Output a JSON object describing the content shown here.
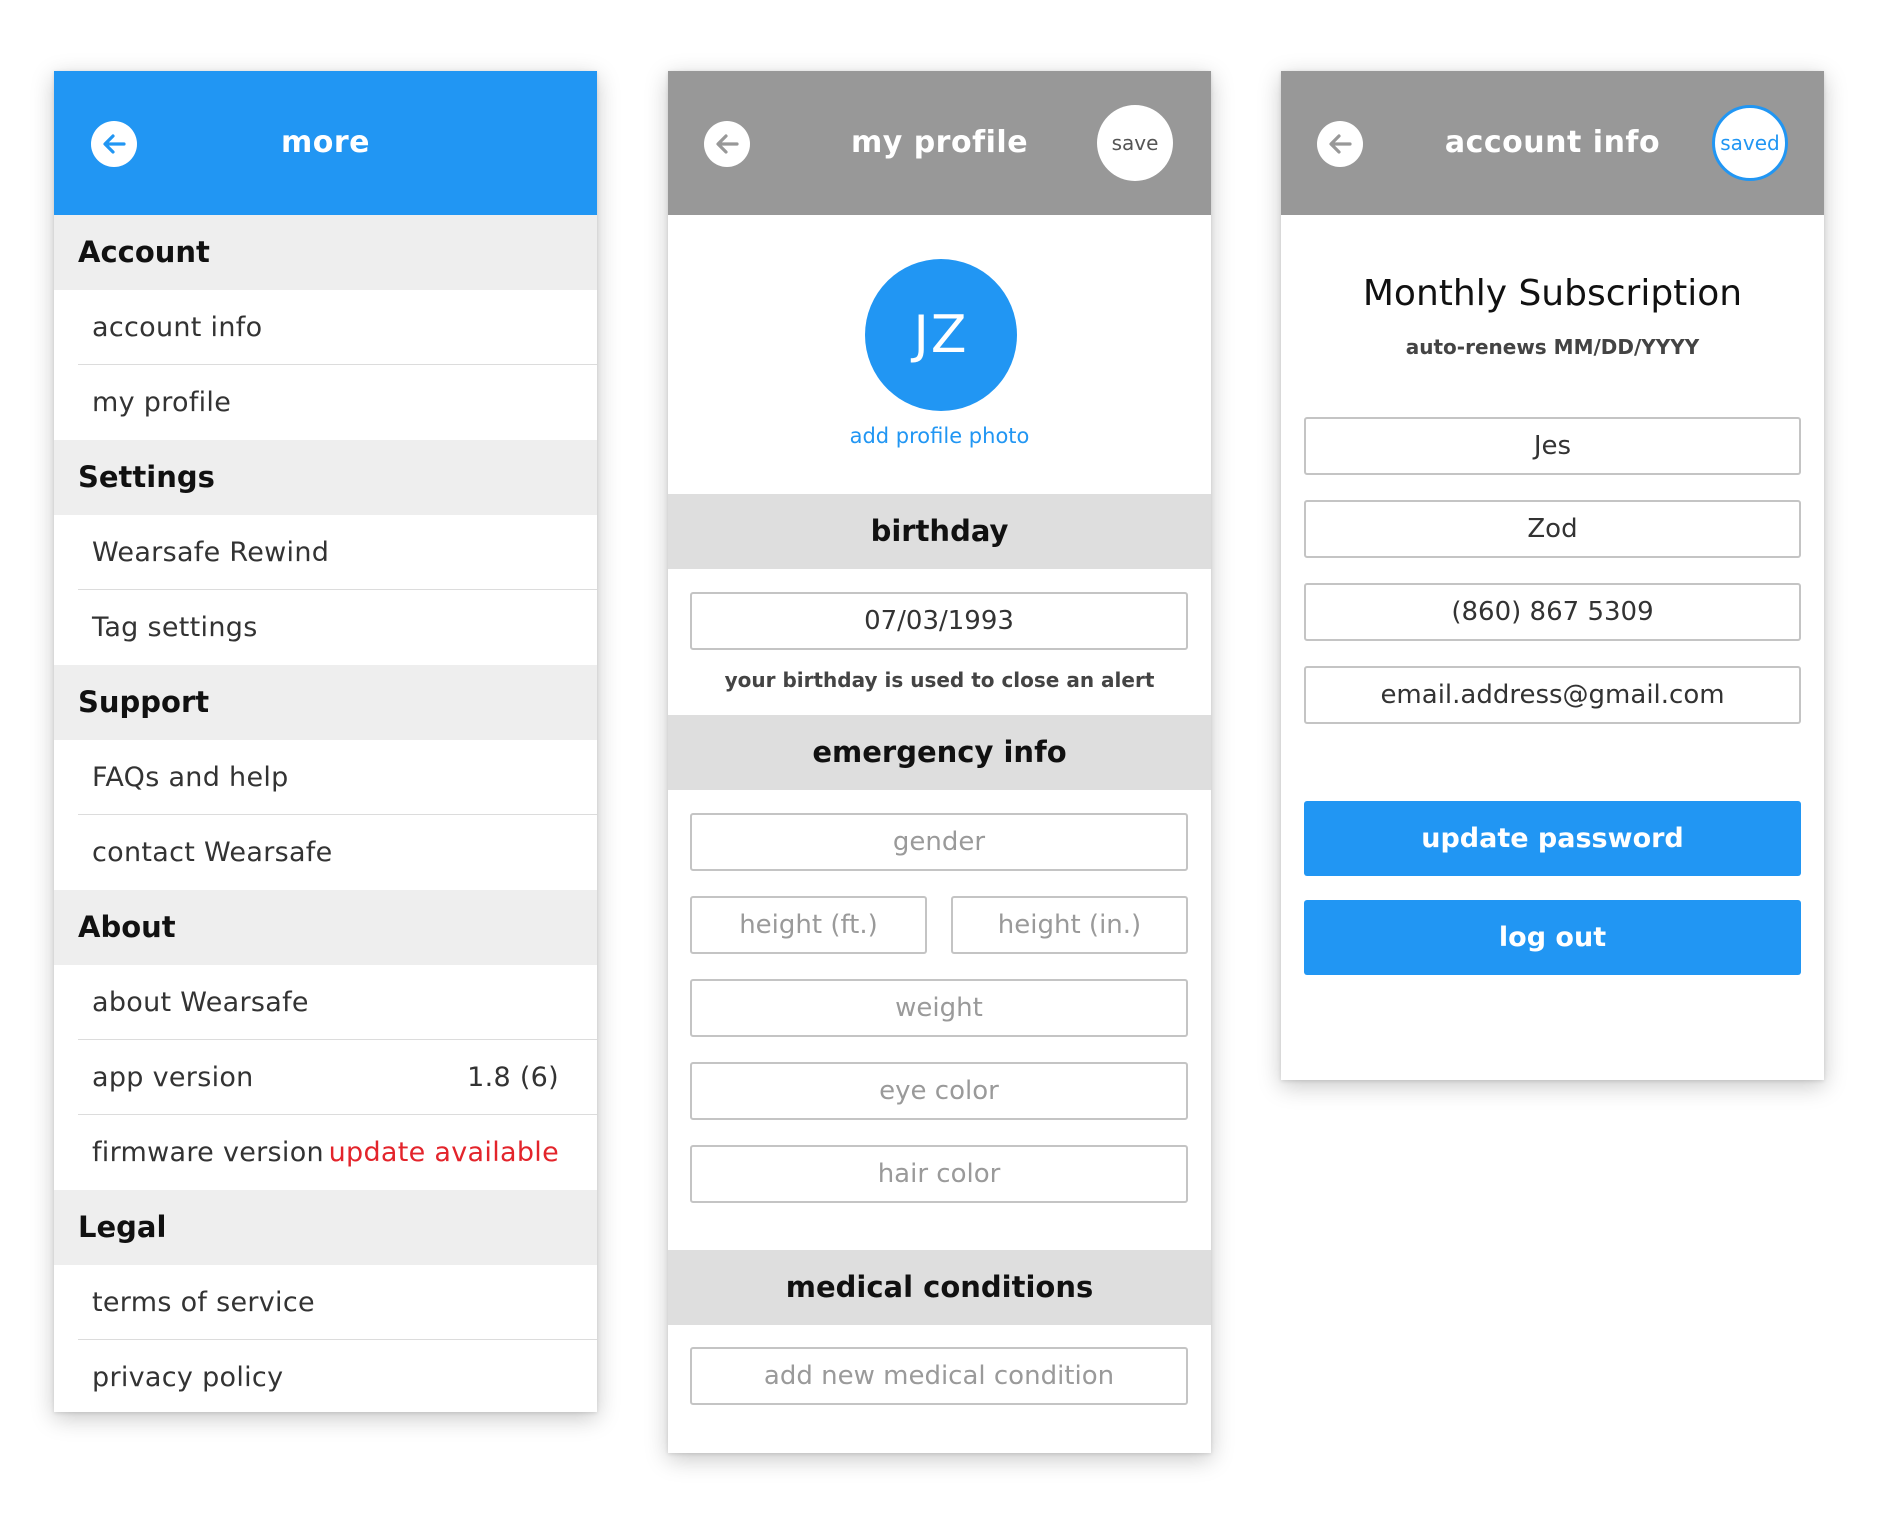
{
  "colors": {
    "accent": "#2196f3",
    "header_gray": "#989898",
    "warning": "#e3242b"
  },
  "more": {
    "title": "more",
    "back_icon": "arrow-left-icon",
    "sections": {
      "account": {
        "title": "Account",
        "items": [
          "account info",
          "my profile"
        ]
      },
      "settings": {
        "title": "Settings",
        "items": [
          "Wearsafe Rewind",
          "Tag settings"
        ]
      },
      "support": {
        "title": "Support",
        "items": [
          "FAQs and help",
          "contact Wearsafe"
        ]
      },
      "about": {
        "title": "About",
        "about_wearsafe": "about Wearsafe",
        "app_version_label": "app version",
        "app_version_value": "1.8 (6)",
        "firmware_label": "firmware version",
        "firmware_value": "update available"
      },
      "legal": {
        "title": "Legal",
        "items": [
          "terms of service",
          "privacy policy"
        ]
      }
    }
  },
  "profile": {
    "title": "my profile",
    "save_label": "save",
    "avatar_initials": "JZ",
    "add_photo": "add profile photo",
    "birthday": {
      "title": "birthday",
      "value": "07/03/1993",
      "note": "your birthday is used to close an alert"
    },
    "emergency": {
      "title": "emergency info",
      "gender": "gender",
      "height_ft": "height (ft.)",
      "height_in": "height (in.)",
      "weight": "weight",
      "eye_color": "eye color",
      "hair_color": "hair color"
    },
    "medical": {
      "title": "medical conditions",
      "add": "add new medical condition"
    }
  },
  "account": {
    "title": "account info",
    "saved_label": "saved",
    "subscription_title": "Monthly Subscription",
    "subscription_note": "auto-renews MM/DD/YYYY",
    "first_name": "Jes",
    "last_name": "Zod",
    "phone": "(860) 867 5309",
    "email": "email.address@gmail.com",
    "update_password": "update password",
    "log_out": "log out"
  }
}
